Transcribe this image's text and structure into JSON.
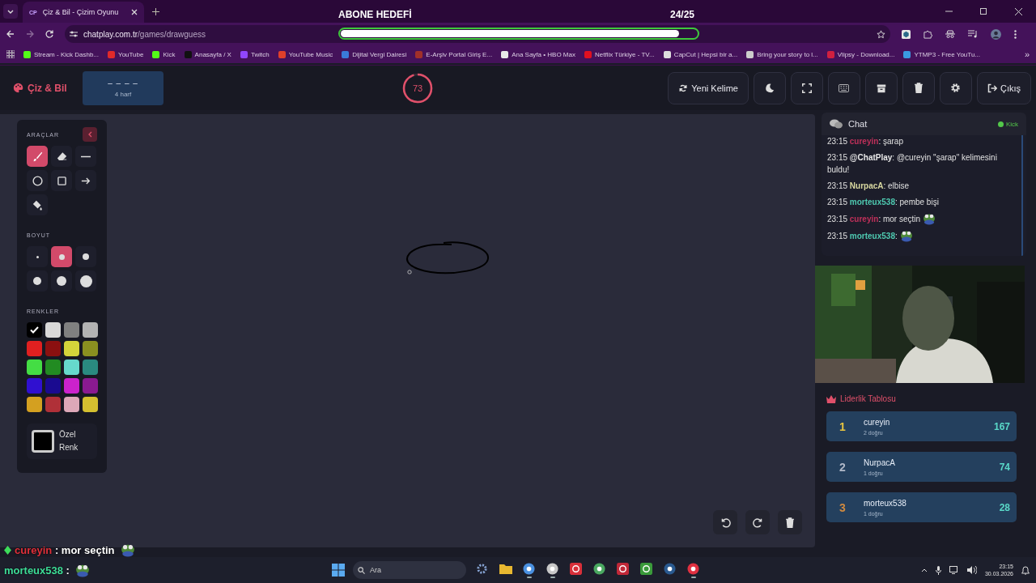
{
  "browser": {
    "tab_title": "Çiz & Bil - Çizim Oyunu",
    "favicon": "CP",
    "url_host": "chatplay.com.tr",
    "url_path": "/games/drawguess",
    "bookmarks": [
      {
        "label": "Stream - Kick Dashb...",
        "color": "#53fc18"
      },
      {
        "label": "YouTube",
        "color": "#e02a2a"
      },
      {
        "label": "Kick",
        "color": "#53fc18"
      },
      {
        "label": "Anasayfa / X",
        "color": "#111111"
      },
      {
        "label": "Twitch",
        "color": "#9146ff"
      },
      {
        "label": "YouTube Music",
        "color": "#e0402a"
      },
      {
        "label": "Dijital Vergi Dairesi",
        "color": "#3a7ad8"
      },
      {
        "label": "E-Arşiv Portal Giriş E...",
        "color": "#a0302a"
      },
      {
        "label": "Ana Sayfa • HBO Max",
        "color": "#e8e8e8"
      },
      {
        "label": "Netflix Türkiye - TV...",
        "color": "#e01020"
      },
      {
        "label": "CapCut | Hepsi bir a...",
        "color": "#dddddd"
      },
      {
        "label": "Bring your story to l...",
        "color": "#cccccc"
      },
      {
        "label": "Vlipsy - Download...",
        "color": "#d02040"
      },
      {
        "label": "YTMP3 - Free YouTu...",
        "color": "#3a9ae0"
      }
    ],
    "more": "»"
  },
  "overlay": {
    "goal_title": "ABONE HEDEFİ",
    "goal_count": "24/25",
    "level": 0.95,
    "chat": [
      {
        "user": "cureyin",
        "color": "#e0303a",
        "text": ": mor seçtin",
        "emote": true
      },
      {
        "user": "morteux538",
        "color": "#3ddc97",
        "text": ":",
        "emote": true
      }
    ]
  },
  "header": {
    "logo": "Çiz & Bil",
    "word": "– – – –",
    "word_hint": "4 harf",
    "timer": {
      "value": "73",
      "level": 0.95
    },
    "buttons": [
      {
        "kind": "refresh",
        "label": "Yeni Kelime"
      },
      {
        "kind": "moon"
      },
      {
        "kind": "fullscreen"
      },
      {
        "kind": "keyboard"
      },
      {
        "kind": "archive"
      },
      {
        "kind": "trash"
      },
      {
        "kind": "gear"
      },
      {
        "kind": "logout",
        "label": "Çıkış"
      }
    ]
  },
  "tools": {
    "title": "ARAÇLAR",
    "items": [
      {
        "kind": "brush",
        "selected": true
      },
      {
        "kind": "eraser",
        "selected": false
      },
      {
        "kind": "line",
        "selected": false
      },
      {
        "kind": "circle",
        "selected": false
      },
      {
        "kind": "rect",
        "selected": false
      },
      {
        "kind": "arrow",
        "selected": false
      },
      {
        "kind": "fill",
        "selected": false
      }
    ],
    "size_title": "BOYUT",
    "sizes": [
      {
        "selected": false
      },
      {
        "selected": true
      },
      {
        "selected": false
      },
      {
        "selected": false
      },
      {
        "selected": false
      },
      {
        "selected": false
      }
    ],
    "colors_title": "RENKLER",
    "colors": [
      {
        "color": "#000000",
        "selected": true
      },
      {
        "color": "#d9d9d9",
        "selected": false
      },
      {
        "color": "#808080",
        "selected": false
      },
      {
        "color": "#b3b3b3",
        "selected": false
      },
      {
        "color": "#e02020",
        "selected": false
      },
      {
        "color": "#8b1010",
        "selected": false
      },
      {
        "color": "#d4d43a",
        "selected": false
      },
      {
        "color": "#8a9020",
        "selected": false
      },
      {
        "color": "#44dd44",
        "selected": false
      },
      {
        "color": "#228b22",
        "selected": false
      },
      {
        "color": "#66d9cc",
        "selected": false
      },
      {
        "color": "#2a8a80",
        "selected": false
      },
      {
        "color": "#3010d0",
        "selected": false
      },
      {
        "color": "#1a0a90",
        "selected": false
      },
      {
        "color": "#cc22cc",
        "selected": false
      },
      {
        "color": "#8a1a90",
        "selected": false
      },
      {
        "color": "#d4a020",
        "selected": false
      },
      {
        "color": "#b03038",
        "selected": false
      },
      {
        "color": "#dda8b8",
        "selected": false
      },
      {
        "color": "#d4c030",
        "selected": false
      }
    ],
    "custom_color": {
      "label": "Özel Renk",
      "color": "#000000"
    }
  },
  "chat": {
    "title": "Chat",
    "platform": "Kick",
    "messages": [
      {
        "time": "23:15",
        "user": "cureyin",
        "color": "#c0305a",
        "text": ": şarap",
        "emote": false
      },
      {
        "time": "23:15",
        "user": "@ChatPlay",
        "color": "#e8e8e8",
        "text": ": @cureyin \"şarap\" kelimesini buldu!",
        "emote": false
      },
      {
        "time": "23:15",
        "user": "NurpacA",
        "color": "#d8d8a0",
        "text": ": elbise",
        "emote": false
      },
      {
        "time": "23:15",
        "user": "morteux538",
        "color": "#4ec9b0",
        "text": ": pembe bişi",
        "emote": false
      },
      {
        "time": "23:15",
        "user": "cureyin",
        "color": "#c0305a",
        "text": ": mor seçtin",
        "emote": true
      },
      {
        "time": "23:15",
        "user": "morteux538",
        "color": "#4ec9b0",
        "text": ":",
        "emote": true
      }
    ]
  },
  "leaderboard": {
    "title": "Liderlik Tablosu",
    "entries": [
      {
        "rank": "1",
        "name": "cureyin",
        "detail": "2 doğru",
        "score": "167",
        "color": "#e8c440"
      },
      {
        "rank": "2",
        "name": "NurpacA",
        "detail": "1 doğru",
        "score": "74",
        "color": "#b0b8c8"
      },
      {
        "rank": "3",
        "name": "morteux538",
        "detail": "1 doğru",
        "score": "28",
        "color": "#d08a40"
      }
    ]
  },
  "taskbar": {
    "search_placeholder": "Ara",
    "apps": [
      {
        "kind": "gear",
        "color": "#8aa8d8",
        "selected": false
      },
      {
        "kind": "folder",
        "color": "#e8b830",
        "selected": false
      },
      {
        "kind": "round",
        "color": "#4a90e0",
        "selected": true
      },
      {
        "kind": "round",
        "color": "#c8c8c8",
        "selected": true
      },
      {
        "kind": "square",
        "color": "#d8303a",
        "selected": false
      },
      {
        "kind": "round",
        "color": "#4aa860",
        "selected": false
      },
      {
        "kind": "square",
        "color": "#c02838",
        "selected": false
      },
      {
        "kind": "square",
        "color": "#3a9a3a",
        "selected": false
      },
      {
        "kind": "round",
        "color": "#2a5a90",
        "selected": false
      },
      {
        "kind": "round",
        "color": "#e03040",
        "selected": true
      }
    ],
    "time": "23:15",
    "date": "30.03.2026"
  }
}
